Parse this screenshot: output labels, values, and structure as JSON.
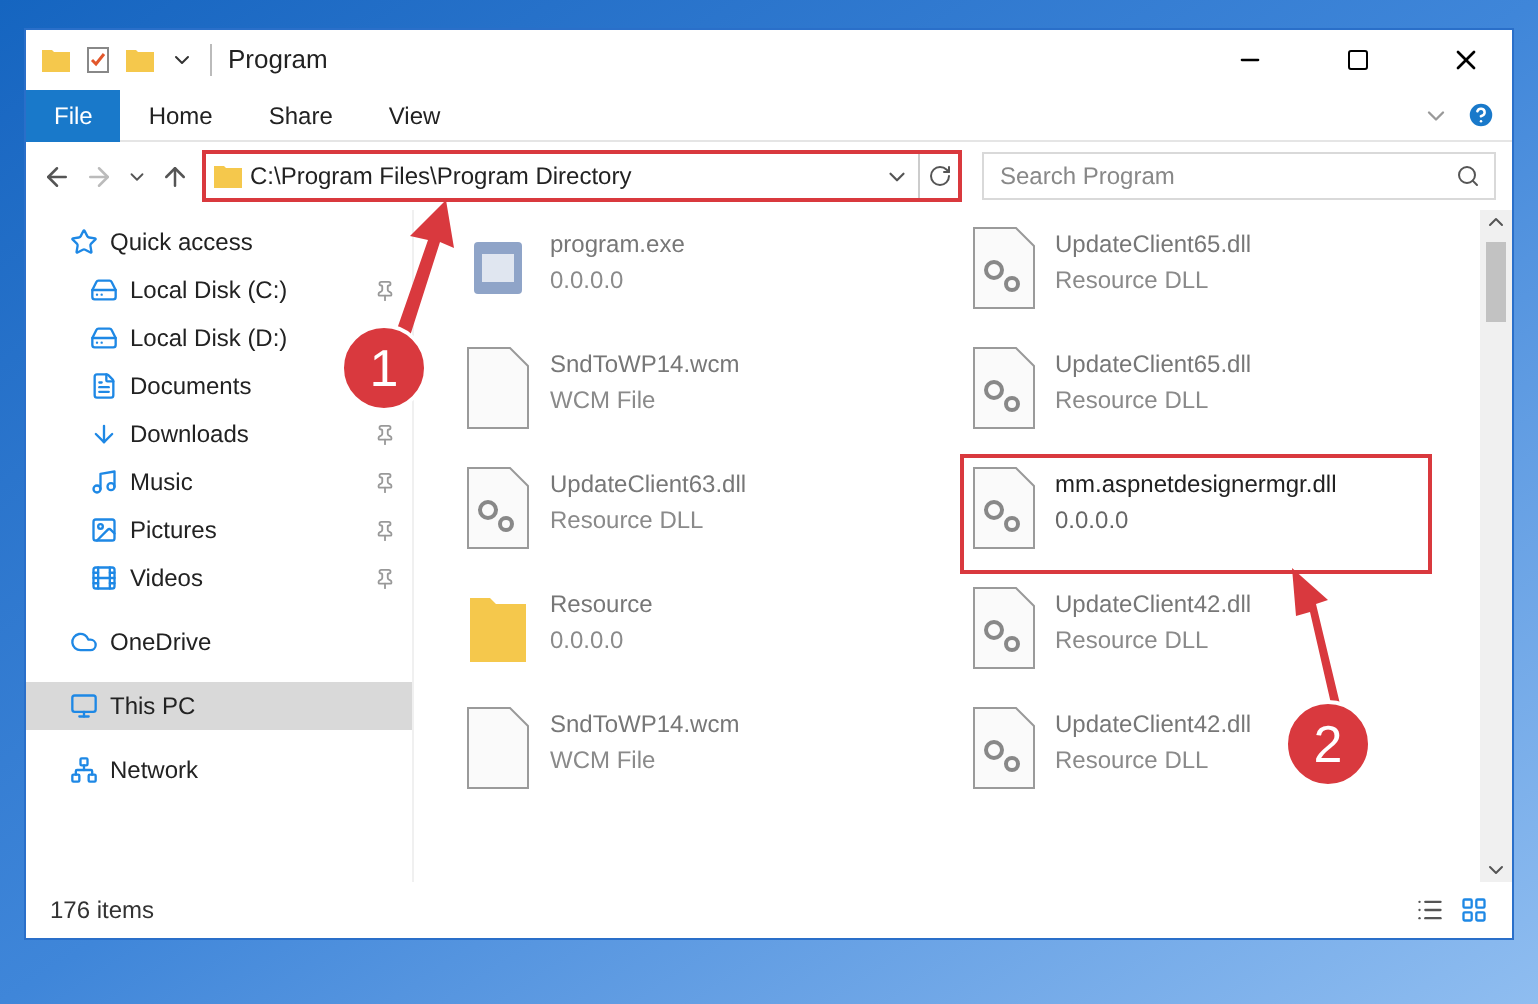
{
  "window": {
    "title": "Program"
  },
  "ribbon_tabs": [
    {
      "label": "File",
      "selected": true
    },
    {
      "label": "Home",
      "selected": false
    },
    {
      "label": "Share",
      "selected": false
    },
    {
      "label": "View",
      "selected": false
    }
  ],
  "address": {
    "path": "C:\\Program Files\\Program Directory",
    "highlighted": true
  },
  "search": {
    "placeholder": "Search Program"
  },
  "sidebar": {
    "items": [
      {
        "label": "Quick access",
        "kind": "star",
        "pinned": false,
        "selected": false,
        "children": [
          {
            "label": "Local Disk (C:)",
            "kind": "drive",
            "pinned": true,
            "selected": false
          },
          {
            "label": "Local Disk (D:)",
            "kind": "drive",
            "selected": false
          },
          {
            "label": "Documents",
            "kind": "documents",
            "selected": false
          },
          {
            "label": "Downloads",
            "kind": "downloads",
            "pinned": true,
            "selected": false
          },
          {
            "label": "Music",
            "kind": "music",
            "pinned": true,
            "selected": false
          },
          {
            "label": "Pictures",
            "kind": "pictures",
            "pinned": true,
            "selected": false
          },
          {
            "label": "Videos",
            "kind": "videos",
            "pinned": true,
            "selected": false
          }
        ]
      },
      {
        "label": "OneDrive",
        "kind": "cloud",
        "pinned": false,
        "selected": false
      },
      {
        "label": "This PC",
        "kind": "pc",
        "pinned": false,
        "selected": true
      },
      {
        "label": "Network",
        "kind": "network",
        "pinned": false,
        "selected": false
      }
    ]
  },
  "files": [
    {
      "name": "program.exe",
      "detail": "0.0.0.0",
      "kind": "exe",
      "faded": true,
      "highlighted": false
    },
    {
      "name": "UpdateClient65.dll",
      "detail": "Resource DLL",
      "kind": "dll",
      "faded": true,
      "highlighted": false
    },
    {
      "name": "SndToWP14.wcm",
      "detail": "WCM File",
      "kind": "file",
      "faded": true,
      "highlighted": false
    },
    {
      "name": "UpdateClient65.dll",
      "detail": "Resource DLL",
      "kind": "dll",
      "faded": true,
      "highlighted": false
    },
    {
      "name": "UpdateClient63.dll",
      "detail": "Resource DLL",
      "kind": "dll",
      "faded": true,
      "highlighted": false
    },
    {
      "name": "mm.aspnetdesignermgr.dll",
      "detail": "0.0.0.0",
      "kind": "dll",
      "faded": false,
      "highlighted": true
    },
    {
      "name": "Resource",
      "detail": "0.0.0.0",
      "kind": "folder",
      "faded": true,
      "highlighted": false
    },
    {
      "name": "UpdateClient42.dll",
      "detail": "Resource DLL",
      "kind": "dll",
      "faded": true,
      "highlighted": false
    },
    {
      "name": "SndToWP14.wcm",
      "detail": "WCM File",
      "kind": "file",
      "faded": true,
      "highlighted": false
    },
    {
      "name": "UpdateClient42.dll",
      "detail": "Resource DLL",
      "kind": "dll",
      "faded": true,
      "highlighted": false
    }
  ],
  "status_bar": {
    "count": "176 items"
  },
  "annotations": [
    {
      "label": "1"
    },
    {
      "label": "2"
    }
  ]
}
